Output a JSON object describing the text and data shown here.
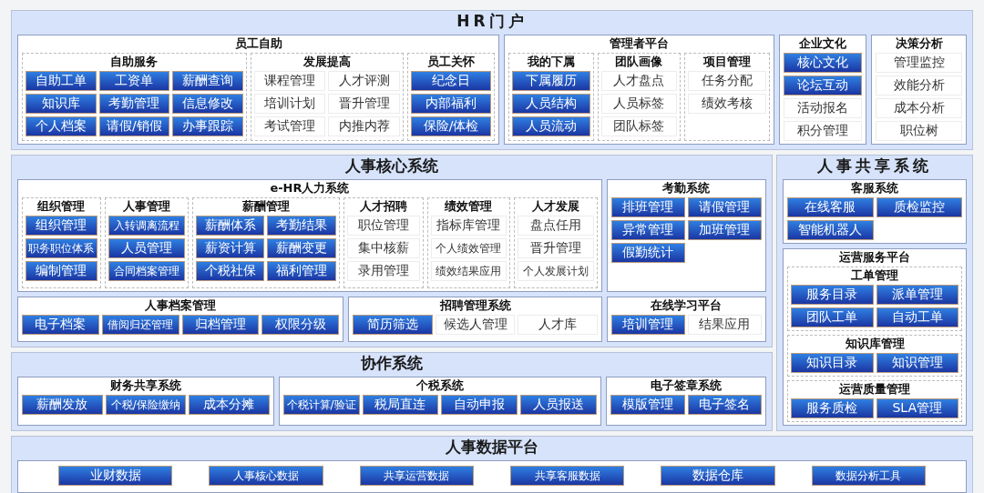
{
  "panels": [
    {
      "title": "HR门户",
      "sections": [
        {
          "title": "员工自助",
          "groups": [
            {
              "title": "自助服务",
              "rows": [
                [
                  {
                    "label": "自助工单",
                    "kind": "blue"
                  },
                  {
                    "label": "工资单",
                    "kind": "blue"
                  },
                  {
                    "label": "薪酬查询",
                    "kind": "blue"
                  }
                ],
                [
                  {
                    "label": "知识库",
                    "kind": "blue"
                  },
                  {
                    "label": "考勤管理",
                    "kind": "blue"
                  },
                  {
                    "label": "信息修改",
                    "kind": "blue"
                  }
                ],
                [
                  {
                    "label": "个人档案",
                    "kind": "blue"
                  },
                  {
                    "label": "请假/销假",
                    "kind": "blue"
                  },
                  {
                    "label": "办事跟踪",
                    "kind": "blue"
                  }
                ]
              ]
            },
            {
              "title": "发展提高",
              "rows": [
                [
                  {
                    "label": "课程管理",
                    "kind": "plain"
                  },
                  {
                    "label": "人才评测",
                    "kind": "plain"
                  }
                ],
                [
                  {
                    "label": "培训计划",
                    "kind": "plain"
                  },
                  {
                    "label": "晋升管理",
                    "kind": "plain"
                  }
                ],
                [
                  {
                    "label": "考试管理",
                    "kind": "plain"
                  },
                  {
                    "label": "内推内荐",
                    "kind": "plain"
                  }
                ]
              ]
            },
            {
              "title": "员工关怀",
              "rows": [
                [
                  {
                    "label": "纪念日",
                    "kind": "blue"
                  }
                ],
                [
                  {
                    "label": "内部福利",
                    "kind": "blue"
                  }
                ],
                [
                  {
                    "label": "保险/体检",
                    "kind": "blue"
                  }
                ]
              ]
            }
          ]
        },
        {
          "title": "管理者平台",
          "groups": [
            {
              "title": "我的下属",
              "rows": [
                [
                  {
                    "label": "下属履历",
                    "kind": "blue"
                  }
                ],
                [
                  {
                    "label": "人员结构",
                    "kind": "blue"
                  }
                ],
                [
                  {
                    "label": "人员流动",
                    "kind": "blue"
                  }
                ]
              ]
            },
            {
              "title": "团队画像",
              "rows": [
                [
                  {
                    "label": "人才盘点",
                    "kind": "plain"
                  }
                ],
                [
                  {
                    "label": "人员标签",
                    "kind": "plain"
                  }
                ],
                [
                  {
                    "label": "团队标签",
                    "kind": "plain"
                  }
                ]
              ]
            },
            {
              "title": "项目管理",
              "rows": [
                [
                  {
                    "label": "任务分配",
                    "kind": "plain"
                  }
                ],
                [
                  {
                    "label": "绩效考核",
                    "kind": "plain"
                  }
                ]
              ]
            }
          ]
        },
        {
          "title": "企业文化",
          "rows": [
            [
              {
                "label": "核心文化",
                "kind": "blue"
              }
            ],
            [
              {
                "label": "论坛互动",
                "kind": "blue"
              }
            ],
            [
              {
                "label": "活动报名",
                "kind": "plain"
              }
            ],
            [
              {
                "label": "积分管理",
                "kind": "plain"
              }
            ]
          ]
        },
        {
          "title": "决策分析",
          "rows": [
            [
              {
                "label": "管理监控",
                "kind": "plain"
              }
            ],
            [
              {
                "label": "效能分析",
                "kind": "plain"
              }
            ],
            [
              {
                "label": "成本分析",
                "kind": "plain"
              }
            ],
            [
              {
                "label": "职位树",
                "kind": "plain"
              }
            ]
          ]
        }
      ]
    },
    {
      "title": "人事核心系统",
      "sections": [
        {
          "title": "e-HR人力系统",
          "groups": [
            {
              "title": "组织管理",
              "rows": [
                [
                  {
                    "label": "组织管理",
                    "kind": "blue"
                  }
                ],
                [
                  {
                    "label": "职务职位体系",
                    "kind": "blue"
                  }
                ],
                [
                  {
                    "label": "编制管理",
                    "kind": "blue"
                  }
                ]
              ]
            },
            {
              "title": "人事管理",
              "rows": [
                [
                  {
                    "label": "入转调离流程",
                    "kind": "blue"
                  }
                ],
                [
                  {
                    "label": "人员管理",
                    "kind": "blue"
                  }
                ],
                [
                  {
                    "label": "合同档案管理",
                    "kind": "blue"
                  }
                ]
              ]
            },
            {
              "title": "薪酬管理",
              "rows": [
                [
                  {
                    "label": "薪酬体系",
                    "kind": "blue"
                  },
                  {
                    "label": "考勤结果",
                    "kind": "blue"
                  }
                ],
                [
                  {
                    "label": "薪资计算",
                    "kind": "blue"
                  },
                  {
                    "label": "薪酬变更",
                    "kind": "blue"
                  }
                ],
                [
                  {
                    "label": "个税社保",
                    "kind": "blue"
                  },
                  {
                    "label": "福利管理",
                    "kind": "blue"
                  }
                ]
              ]
            },
            {
              "title": "人才招聘",
              "rows": [
                [
                  {
                    "label": "职位管理",
                    "kind": "plain"
                  }
                ],
                [
                  {
                    "label": "集中核薪",
                    "kind": "plain"
                  }
                ],
                [
                  {
                    "label": "录用管理",
                    "kind": "plain"
                  }
                ]
              ]
            },
            {
              "title": "绩效管理",
              "rows": [
                [
                  {
                    "label": "指标库管理",
                    "kind": "plain"
                  }
                ],
                [
                  {
                    "label": "个人绩效管理",
                    "kind": "plain"
                  }
                ],
                [
                  {
                    "label": "绩效结果应用",
                    "kind": "plain"
                  }
                ]
              ]
            },
            {
              "title": "人才发展",
              "rows": [
                [
                  {
                    "label": "盘点任用",
                    "kind": "plain"
                  }
                ],
                [
                  {
                    "label": "晋升管理",
                    "kind": "plain"
                  }
                ],
                [
                  {
                    "label": "个人发展计划",
                    "kind": "plain"
                  }
                ]
              ]
            }
          ]
        },
        {
          "title": "考勤系统",
          "rows": [
            [
              {
                "label": "排班管理",
                "kind": "blue"
              },
              {
                "label": "请假管理",
                "kind": "blue"
              }
            ],
            [
              {
                "label": "异常管理",
                "kind": "blue"
              },
              {
                "label": "加班管理",
                "kind": "blue"
              }
            ],
            [
              {
                "label": "假勤统计",
                "kind": "blue"
              }
            ]
          ]
        },
        {
          "title": "人事档案管理",
          "rows": [
            [
              {
                "label": "电子档案",
                "kind": "blue"
              },
              {
                "label": "借阅归还管理",
                "kind": "blue"
              },
              {
                "label": "归档管理",
                "kind": "blue"
              },
              {
                "label": "权限分级",
                "kind": "blue"
              }
            ]
          ]
        },
        {
          "title": "招聘管理系统",
          "rows": [
            [
              {
                "label": "简历筛选",
                "kind": "blue"
              },
              {
                "label": "候选人管理",
                "kind": "plain"
              },
              {
                "label": "人才库",
                "kind": "plain"
              }
            ]
          ]
        },
        {
          "title": "在线学习平台",
          "rows": [
            [
              {
                "label": "培训管理",
                "kind": "blue"
              },
              {
                "label": "结果应用",
                "kind": "plain"
              }
            ]
          ]
        }
      ]
    },
    {
      "title": "协作系统",
      "sections": [
        {
          "title": "财务共享系统",
          "rows": [
            [
              {
                "label": "薪酬发放",
                "kind": "blue"
              },
              {
                "label": "个税/保险缴纳",
                "kind": "blue"
              },
              {
                "label": "成本分摊",
                "kind": "blue"
              }
            ]
          ]
        },
        {
          "title": "个税系统",
          "rows": [
            [
              {
                "label": "个税计算/验证",
                "kind": "blue"
              },
              {
                "label": "税局直连",
                "kind": "blue"
              },
              {
                "label": "自动申报",
                "kind": "blue"
              },
              {
                "label": "人员报送",
                "kind": "blue"
              }
            ]
          ]
        },
        {
          "title": "电子签章系统",
          "rows": [
            [
              {
                "label": "模版管理",
                "kind": "blue"
              },
              {
                "label": "电子签名",
                "kind": "blue"
              }
            ]
          ]
        }
      ]
    },
    {
      "title": "人事共享系统",
      "sections": [
        {
          "title": "客服系统",
          "rows": [
            [
              {
                "label": "在线客服",
                "kind": "blue"
              },
              {
                "label": "质检监控",
                "kind": "blue"
              }
            ],
            [
              {
                "label": "智能机器人",
                "kind": "blue"
              }
            ]
          ]
        },
        {
          "title": "运营服务平台",
          "groups": [
            {
              "title": "工单管理",
              "rows": [
                [
                  {
                    "label": "服务目录",
                    "kind": "blue"
                  },
                  {
                    "label": "派单管理",
                    "kind": "blue"
                  }
                ],
                [
                  {
                    "label": "团队工单",
                    "kind": "blue"
                  },
                  {
                    "label": "自动工单",
                    "kind": "blue"
                  }
                ]
              ]
            },
            {
              "title": "知识库管理",
              "rows": [
                [
                  {
                    "label": "知识目录",
                    "kind": "blue"
                  },
                  {
                    "label": "知识管理",
                    "kind": "blue"
                  }
                ]
              ]
            },
            {
              "title": "运营质量管理",
              "rows": [
                [
                  {
                    "label": "服务质检",
                    "kind": "blue"
                  },
                  {
                    "label": "SLA管理",
                    "kind": "blue"
                  }
                ]
              ]
            }
          ]
        }
      ]
    },
    {
      "title": "人事数据平台",
      "sections": [
        {
          "rows": [
            [
              {
                "label": "业财数据",
                "kind": "blue"
              },
              {
                "label": "人事核心数据",
                "kind": "blue"
              },
              {
                "label": "共享运营数据",
                "kind": "blue"
              },
              {
                "label": "共享客服数据",
                "kind": "blue"
              },
              {
                "label": "数据仓库",
                "kind": "blue"
              },
              {
                "label": "数据分析工具",
                "kind": "blue"
              }
            ]
          ]
        }
      ]
    }
  ]
}
